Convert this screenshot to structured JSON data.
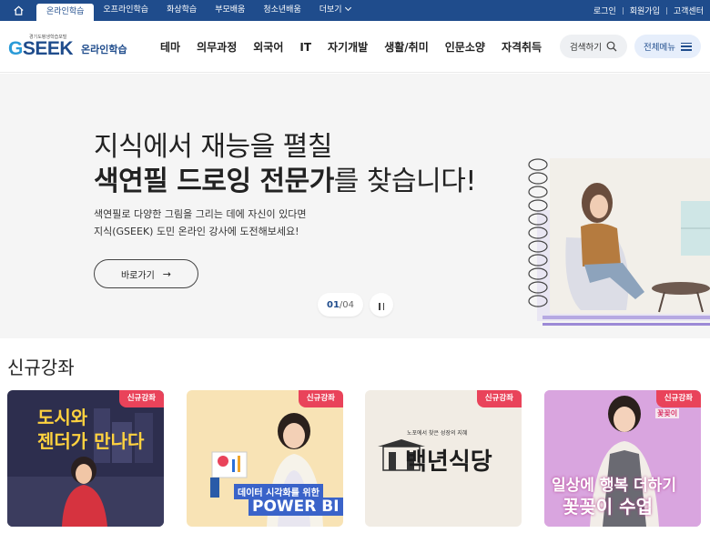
{
  "topbar": {
    "nav": [
      {
        "label": "온라인학습",
        "active": true
      },
      {
        "label": "오프라인학습",
        "active": false
      },
      {
        "label": "화상학습",
        "active": false
      },
      {
        "label": "부모배움",
        "active": false
      },
      {
        "label": "청소년배움",
        "active": false
      },
      {
        "label": "더보기",
        "active": false
      }
    ],
    "util": [
      "로그인",
      "회원가입",
      "고객센터"
    ]
  },
  "header": {
    "logo_small": "경기도평생학습포털",
    "logo_main": "GSEEK",
    "logo_sub": "온라인학습",
    "nav": [
      "테마",
      "의무과정",
      "외국어",
      "IT",
      "자기개발",
      "생활/취미",
      "인문소양",
      "자격취득"
    ],
    "search_label": "검색하기",
    "menu_label": "전체메뉴"
  },
  "hero": {
    "line1": "지식에서 재능을 펼칠",
    "line2_bold": "색연필 드로잉 전문가",
    "line2_rest": "를 찾습니다!",
    "desc1": "색연필로 다양한 그림을 그리는 데에 자신이 있다면",
    "desc2": "지식(GSEEK) 도민 온라인 강사에 도전해보세요!",
    "button": "바로가기",
    "pager_current": "01",
    "pager_total": "04"
  },
  "new_courses": {
    "title": "신규강좌",
    "cards": [
      {
        "badge": "신규강좌",
        "line1": "도시와",
        "line2": "젠더가 만나다"
      },
      {
        "badge": "신규강좌",
        "line1": "데이터 시각화를 위한",
        "line2": "POWER BI"
      },
      {
        "badge": "신규강좌",
        "line1": "노포에서 찾은 성장의 지혜",
        "line2": "백년식당"
      },
      {
        "badge": "신규강좌",
        "line1": "일상에 행복 더하기",
        "line2": "꽃꽂이 수업",
        "tag": "꽃꽂이"
      }
    ]
  },
  "colors": {
    "brand": "#1f4c8c",
    "badge": "#e9435a",
    "hero_bg": "#f5f5f5"
  }
}
